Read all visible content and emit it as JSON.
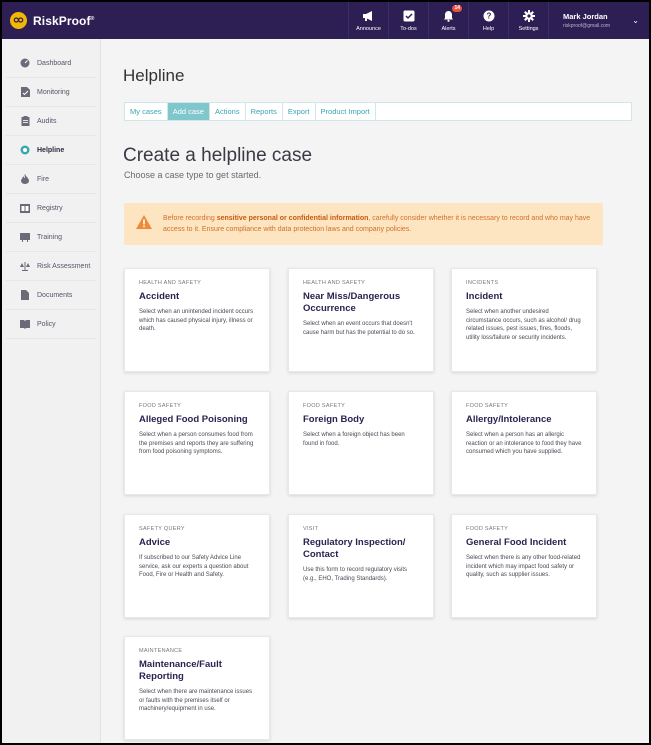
{
  "app": {
    "name": "RiskProof",
    "trademark": "®"
  },
  "topnav": [
    {
      "label": "Announce",
      "icon": "megaphone-icon",
      "badge": ""
    },
    {
      "label": "To-dos",
      "icon": "checkbox-icon",
      "badge": ""
    },
    {
      "label": "Alerts",
      "icon": "bell-icon",
      "badge": "14"
    },
    {
      "label": "Help",
      "icon": "help-circle-icon",
      "badge": ""
    },
    {
      "label": "Settings",
      "icon": "gear-icon",
      "badge": ""
    }
  ],
  "user": {
    "name": "Mark Jordan",
    "email": "riskproof@gmail.com"
  },
  "sidebar": {
    "items": [
      {
        "label": "Dashboard",
        "icon": "dashboard-icon",
        "active": false
      },
      {
        "label": "Monitoring",
        "icon": "monitoring-icon",
        "active": false
      },
      {
        "label": "Audits",
        "icon": "clipboard-icon",
        "active": false
      },
      {
        "label": "Helpline",
        "icon": "lifebuoy-icon",
        "active": true
      },
      {
        "label": "Fire",
        "icon": "flame-icon",
        "active": false
      },
      {
        "label": "Registry",
        "icon": "registry-icon",
        "active": false
      },
      {
        "label": "Training",
        "icon": "training-icon",
        "active": false
      },
      {
        "label": "Risk Assessment",
        "icon": "scale-icon",
        "active": false
      },
      {
        "label": "Documents",
        "icon": "document-icon",
        "active": false
      },
      {
        "label": "Policy",
        "icon": "book-icon",
        "active": false
      }
    ]
  },
  "page": {
    "title": "Helpline",
    "tabs": [
      {
        "label": "My cases",
        "active": false
      },
      {
        "label": "Add case",
        "active": true
      },
      {
        "label": "Actions",
        "active": false
      },
      {
        "label": "Reports",
        "active": false
      },
      {
        "label": "Export",
        "active": false
      },
      {
        "label": "Product Import",
        "active": false
      }
    ],
    "heading": "Create a helpline case",
    "subheading": "Choose a case type to get started."
  },
  "warning": {
    "before": "Before recording ",
    "emphasis": "sensitive personal or confidential information",
    "after": ", carefully consider whether it is necessary to record and who may have access to it. Ensure compliance with data protection laws and company policies."
  },
  "cards": [
    {
      "category": "HEALTH AND SAFETY",
      "title": "Accident",
      "description": "Select when an unintended incident occurs which has caused physical injury, illness or death."
    },
    {
      "category": "HEALTH AND SAFETY",
      "title": "Near Miss/Dangerous Occurrence",
      "description": "Select when an event occurs that doesn't cause harm but has the potential to do so."
    },
    {
      "category": "INCIDENTS",
      "title": "Incident",
      "description": "Select when another undesired circumstance occurs, such as alcohol/ drug related issues, pest issues, fires, floods, utility loss/failure or security incidents."
    },
    {
      "category": "FOOD SAFETY",
      "title": "Alleged Food Poisoning",
      "description": "Select when a person consumes food from the premises and reports they are suffering from food poisoning symptoms."
    },
    {
      "category": "FOOD SAFETY",
      "title": "Foreign Body",
      "description": "Select when a foreign object has been found in food."
    },
    {
      "category": "FOOD SAFETY",
      "title": "Allergy/Intolerance",
      "description": "Select when a person has an allergic reaction or an intolerance to food they have consumed which you have supplied."
    },
    {
      "category": "SAFETY QUERY",
      "title": "Advice",
      "description": "If subscribed to our Safety Advice Line service, ask our experts a question about Food, Fire or Health and Safety."
    },
    {
      "category": "VISIT",
      "title": "Regulatory Inspection/ Contact",
      "description": "Use this form to record regulatory visits (e.g., EHO, Trading Standards)."
    },
    {
      "category": "FOOD SAFETY",
      "title": "General Food Incident",
      "description": "Select when there is any other food-related incident which may impact food safety or quality, such as supplier issues."
    },
    {
      "category": "MAINTENANCE",
      "title": "Maintenance/Fault Reporting",
      "description": "Select when there are maintenance issues or faults with the premises itself or machinery/equipment in use."
    }
  ],
  "colors": {
    "topbar": "#2d1f54",
    "accent": "#3aa6b3",
    "warning_bg": "#fde5c1",
    "warning_text": "#d0702a",
    "logo": "#f2b705"
  }
}
